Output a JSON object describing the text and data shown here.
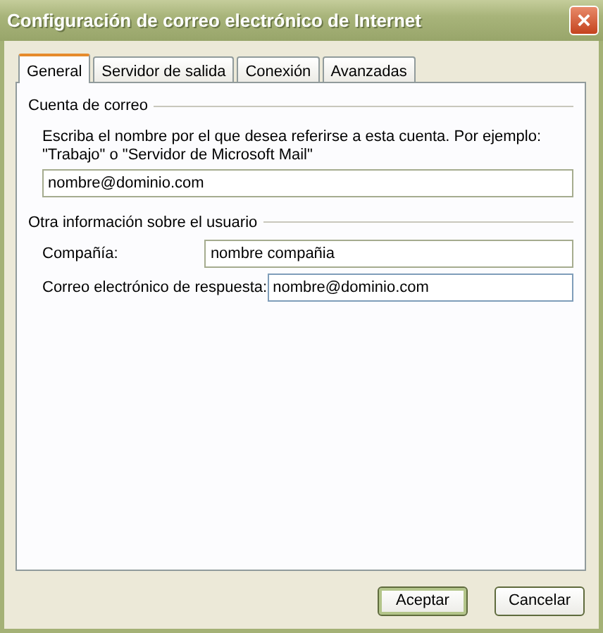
{
  "window": {
    "title": "Configuración de correo electrónico de Internet",
    "close": "×"
  },
  "tabs": [
    {
      "label": "General",
      "selected": true
    },
    {
      "label": "Servidor de salida",
      "selected": false
    },
    {
      "label": "Conexión",
      "selected": false
    },
    {
      "label": "Avanzadas",
      "selected": false
    }
  ],
  "groups": [
    {
      "title": "Cuenta de correo",
      "description": "Escriba el nombre por el que desea referirse a esta cuenta. Por ejemplo: \"Trabajo\" o \"Servidor de Microsoft Mail\"",
      "fields": [
        {
          "value": "nombre@dominio.com"
        }
      ]
    },
    {
      "title": "Otra información sobre el usuario",
      "fields": [
        {
          "label": "Compañía:",
          "value": "nombre compañia"
        },
        {
          "label": "Correo electrónico de respuesta:",
          "value": "nombre@dominio.com",
          "focused": true
        }
      ]
    }
  ],
  "buttons": [
    {
      "label": "Aceptar",
      "default": true
    },
    {
      "label": "Cancelar",
      "default": false
    }
  ]
}
